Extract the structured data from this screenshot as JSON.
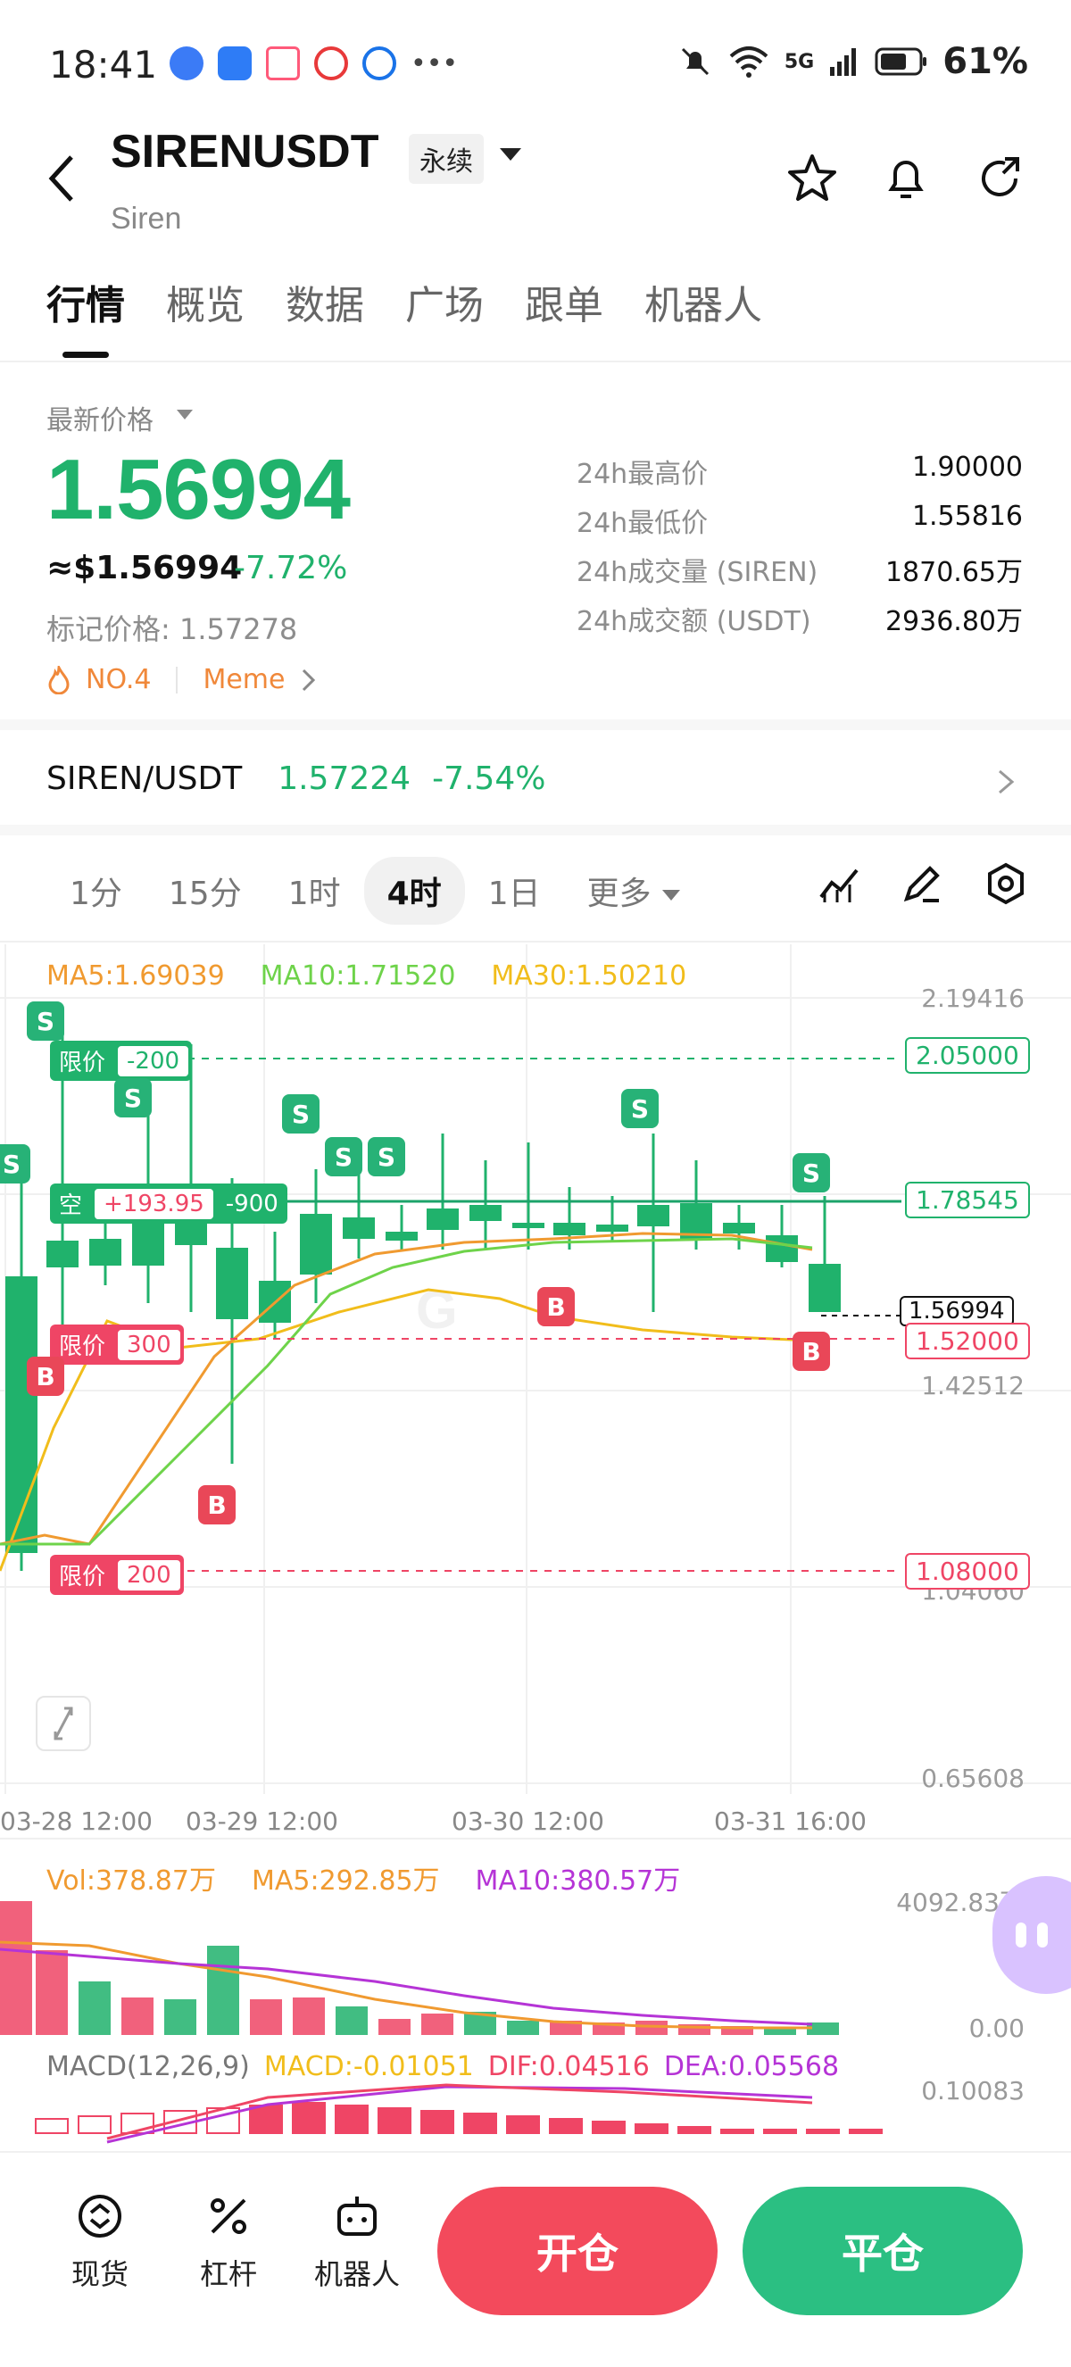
{
  "status_bar": {
    "time": "18:41",
    "network": "5G",
    "battery": "61%"
  },
  "header": {
    "symbol": "SIRENUSDT",
    "contract_type": "永续",
    "name": "Siren"
  },
  "tabs": [
    {
      "label": "行情",
      "active": true
    },
    {
      "label": "概览",
      "active": false
    },
    {
      "label": "数据",
      "active": false
    },
    {
      "label": "广场",
      "active": false
    },
    {
      "label": "跟单",
      "active": false
    },
    {
      "label": "机器人",
      "active": false
    }
  ],
  "price": {
    "latest_label": "最新价格",
    "last": "1.56994",
    "usd": "≈$1.56994",
    "change": "-7.72%",
    "mark": "标记价格: 1.57278",
    "rank": "NO.4",
    "tag": "Meme"
  },
  "stats": [
    {
      "label": "24h最高价",
      "value": "1.90000"
    },
    {
      "label": "24h最低价",
      "value": "1.55816"
    },
    {
      "label": "24h成交量 (SIREN)",
      "value": "1870.65万"
    },
    {
      "label": "24h成交额 (USDT)",
      "value": "2936.80万"
    }
  ],
  "spot": {
    "pair": "SIREN/USDT",
    "price": "1.57224",
    "change": "-7.54%"
  },
  "timeframes": [
    {
      "label": "1分",
      "active": false
    },
    {
      "label": "15分",
      "active": false
    },
    {
      "label": "1时",
      "active": false
    },
    {
      "label": "4时",
      "active": true
    },
    {
      "label": "1日",
      "active": false
    },
    {
      "label": "更多",
      "active": false
    }
  ],
  "chart": {
    "ma_legend": {
      "ma5": "MA5:1.69039",
      "ma10": "MA10:1.71520",
      "ma30": "MA30:1.50210"
    },
    "y_axis": [
      "2.19416",
      "1.42512",
      "1.04060",
      "0.65608"
    ],
    "x_axis": [
      "03-28 12:00",
      "03-29 12:00",
      "03-30 12:00",
      "03-31 16:00"
    ],
    "price_tags": {
      "order_high": "2.05000",
      "position": "1.78545",
      "last": "1.56994",
      "order_mid": "1.52000",
      "order_low": "1.08000"
    },
    "orders": {
      "high": {
        "label": "限价",
        "qty": "-200"
      },
      "position": {
        "label": "空",
        "pnl": "+193.95",
        "qty": "-900"
      },
      "mid": {
        "label": "限价",
        "qty": "300"
      },
      "low": {
        "label": "限价",
        "qty": "200"
      }
    },
    "marker_labels": {
      "sell": "S",
      "buy": "B"
    },
    "colors": {
      "up": "#ef4565",
      "down": "#20b26c",
      "ma5": "#f09a30",
      "ma10": "#6ed34a",
      "ma30": "#f1bd1b"
    }
  },
  "volume": {
    "legend": {
      "vol": "Vol:378.87万",
      "ma5": "MA5:292.85万",
      "ma10": "MA10:380.57万"
    },
    "max": "4092.83万",
    "zero": "0.00"
  },
  "macd": {
    "legend": {
      "name": "MACD(12,26,9)",
      "macd": "MACD:-0.01051",
      "dif": "DIF:0.04516",
      "dea": "DEA:0.05568"
    },
    "max": "0.10083"
  },
  "bottom_bar": {
    "spot": "现货",
    "leverage": "杠杆",
    "bot": "机器人",
    "open": "开仓",
    "close": "平仓"
  }
}
